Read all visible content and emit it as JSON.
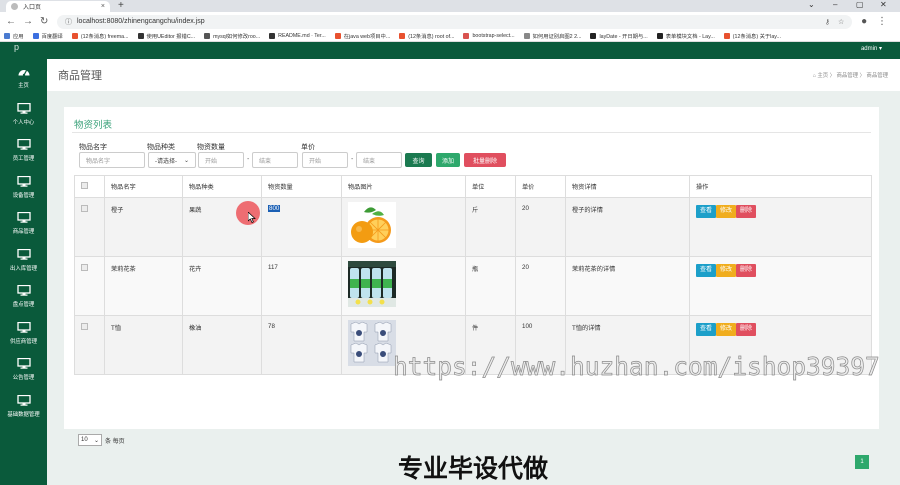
{
  "browser": {
    "tab_title": "入口页",
    "tab_close": "×",
    "new_tab": "+",
    "url": "localhost:8080/zhinengcangchu/index.jsp",
    "window_controls": [
      "⌄",
      "–",
      "▢",
      "✕"
    ],
    "bookmarks": [
      {
        "label": "应用",
        "color": "#4a7bd0"
      },
      {
        "label": "百度翻译",
        "color": "#3b6fe0"
      },
      {
        "label": "(12条消息) freema...",
        "color": "#e8512f"
      },
      {
        "label": "使用UEditor 报错C...",
        "color": "#333333"
      },
      {
        "label": "mysql如何修改roo...",
        "color": "#555555"
      },
      {
        "label": "README.md · Ter...",
        "color": "#333333"
      },
      {
        "label": "在java web项目中...",
        "color": "#e8512f"
      },
      {
        "label": "(12条消息) root of...",
        "color": "#e8512f"
      },
      {
        "label": "bootstrap-select...",
        "color": "#d9534f"
      },
      {
        "label": "如何用证别启图2 2...",
        "color": "#888888"
      },
      {
        "label": "layDate - 开日期与...",
        "color": "#222222"
      },
      {
        "label": "表单模块文档 - Lay...",
        "color": "#222222"
      },
      {
        "label": "(12条消息) 关于lay...",
        "color": "#e8512f"
      }
    ]
  },
  "sidebar": {
    "logo": "p",
    "items": [
      {
        "label": "主页",
        "icon": "dashboard-icon"
      },
      {
        "label": "个人中心",
        "icon": "monitor-icon"
      },
      {
        "label": "员工管理",
        "icon": "monitor-icon"
      },
      {
        "label": "设备管理",
        "icon": "monitor-icon"
      },
      {
        "label": "商品管理",
        "icon": "monitor-icon"
      },
      {
        "label": "出入库管理",
        "icon": "monitor-icon"
      },
      {
        "label": "盘点管理",
        "icon": "monitor-icon"
      },
      {
        "label": "供应商管理",
        "icon": "monitor-icon"
      },
      {
        "label": "公告管理",
        "icon": "monitor-icon"
      },
      {
        "label": "基础数据管理",
        "icon": "monitor-icon"
      }
    ]
  },
  "header": {
    "user": "admin ▾"
  },
  "page": {
    "title": "商品管理",
    "breadcrumb": "⌂ 主页 〉 商品管理 〉 商品管理"
  },
  "card": {
    "title": "物资列表",
    "filters": {
      "name_label": "物品名字",
      "name_placeholder": "物品名字",
      "type_label": "物品种类",
      "type_value": "-请选择-",
      "qty_label": "物资数量",
      "qty_start": "开始",
      "qty_end": "结束",
      "price_label": "单价",
      "price_start": "开始",
      "price_end": "结束",
      "dash": "-"
    },
    "buttons": {
      "search": "查询",
      "add": "添加",
      "batch_delete": "批量删除"
    },
    "table": {
      "headers": [
        "物品名字",
        "物品种类",
        "物资数量",
        "物品图片",
        "单位",
        "单价",
        "物资详情",
        "操作"
      ],
      "rows": [
        {
          "name": "橙子",
          "type": "果蔬",
          "qty": "800",
          "unit": "斤",
          "price": "20",
          "detail": "橙子的详情",
          "img": "orange"
        },
        {
          "name": "茉莉花茶",
          "type": "花卉",
          "qty": "117",
          "unit": "瓶",
          "price": "20",
          "detail": "茉莉花茶的详情",
          "img": "tea"
        },
        {
          "name": "T恤",
          "type": "橡油",
          "qty": "78",
          "unit": "件",
          "price": "100",
          "detail": "T恤的详情",
          "img": "tshirt"
        }
      ],
      "actions": {
        "view": "查看",
        "edit": "修改",
        "delete": "删除"
      }
    },
    "pager": {
      "page_size": "10",
      "per_page_text": "条 每页",
      "current_page": "1"
    }
  },
  "overlay": {
    "watermark": "https://www.huzhan.com/ishop39397",
    "banner": "专业毕设代做"
  },
  "colors": {
    "sidebar": "#0a5a3b",
    "accent": "#3aa17a",
    "search_btn": "#1b7a50",
    "add_btn": "#2ea86c",
    "delete_btn": "#e04f5f",
    "view_btn": "#1c9fc9",
    "edit_btn": "#f0ad1e"
  }
}
